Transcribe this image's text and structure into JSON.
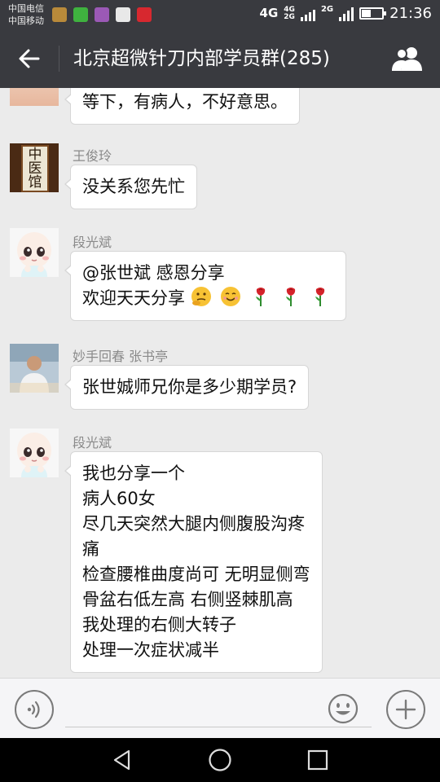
{
  "status_bar": {
    "carrier_1": "中国电信",
    "carrier_2": "中国移动",
    "net_1": "4G",
    "net_2a": "4G",
    "net_2b": "2G",
    "net_3": "2G",
    "battery_level": 0.4,
    "time": "21:36"
  },
  "header": {
    "title": "北京超微针刀内部学员群(285)",
    "back_icon": "arrow-left-icon",
    "members_icon": "group-members-icon"
  },
  "messages": [
    {
      "sender": "",
      "lines": [
        "等下，有病人，不好意思。"
      ]
    },
    {
      "sender": "王俊玲",
      "lines": [
        "没关系您先忙"
      ]
    },
    {
      "sender": "段光斌",
      "lines": [
        "@张世斌 感恩分享",
        "欢迎天天分享"
      ],
      "emojis": [
        "thinking-face-emoji",
        "smiling-face-emoji",
        "rose-emoji",
        "rose-emoji",
        "rose-emoji"
      ]
    },
    {
      "sender": "妙手回春  张书亭",
      "lines": [
        "张世娍师兄你是多少期学员?"
      ]
    },
    {
      "sender": "段光斌",
      "lines": [
        "我也分享一个",
        "病人60女",
        "尽几天突然大腿内侧腹股沟疼",
        "痛",
        "检查腰椎曲度尚可  无明显侧弯",
        "骨盆右低左高  右侧竖棘肌高",
        "我处理的右侧大转子",
        "处理一次症状减半"
      ]
    }
  ],
  "avatar_sign_text": "中医馆",
  "input_bar": {
    "voice_icon": "voice-icon",
    "emoji_icon": "emoji-icon",
    "plus_icon": "plus-icon"
  },
  "colors": {
    "header_bg": "#393a3f",
    "chat_bg": "#ebebeb",
    "bubble_bg": "#ffffff"
  }
}
